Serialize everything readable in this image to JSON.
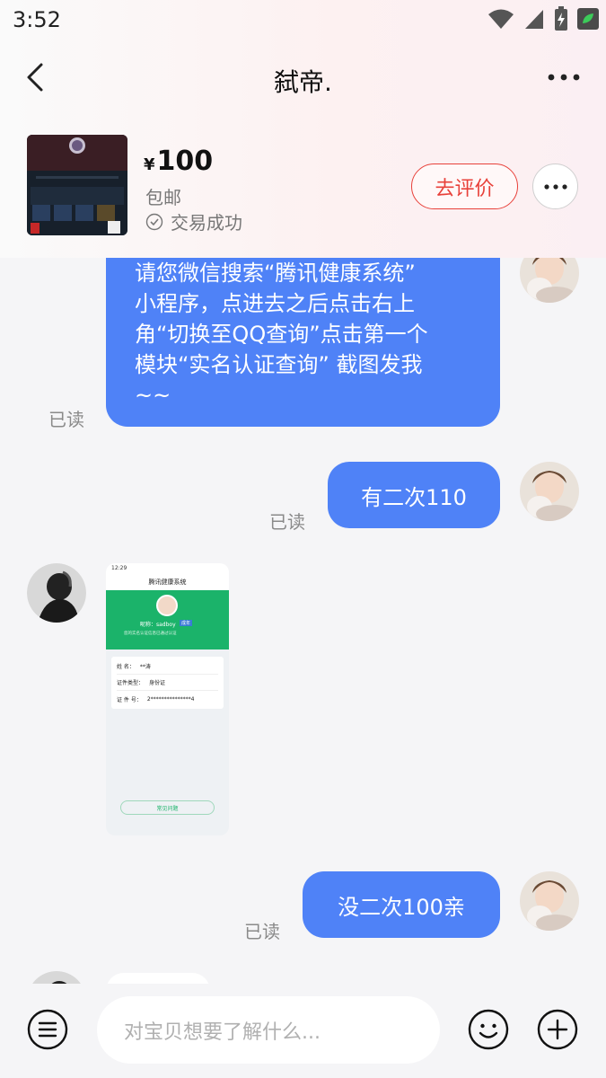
{
  "statusbar": {
    "time": "3:52"
  },
  "header": {
    "title": "弑帝."
  },
  "product": {
    "currency": "¥",
    "price": "100",
    "shipping": "包邮",
    "status": "交易成功",
    "review_button": "去评价"
  },
  "messages": [
    {
      "from": "me",
      "lines": [
        "请您微信搜索“腾讯健康系统”",
        "小程序，点进去之后点击右上",
        "角“切换至QQ查询”点击第一个",
        "模块“实名认证查询” 截图发我",
        "~~"
      ],
      "read": "已读"
    },
    {
      "from": "me",
      "text": "有二次110",
      "read": "已读"
    },
    {
      "from": "them",
      "type": "image",
      "screenshot": {
        "time": "12:29",
        "title": "腾讯健康系统",
        "nickname_label": "昵称：sadboy",
        "tag": "成年",
        "subtitle": "您的实名认证信息已通过认证",
        "rows": [
          {
            "label": "姓  名：",
            "value": "**涛"
          },
          {
            "label": "证件类型：",
            "value": "身份证"
          },
          {
            "label": "证 件 号：",
            "value": "2***************4"
          }
        ],
        "button": "常见问题"
      }
    },
    {
      "from": "me",
      "text": "没二次100亲",
      "read": "已读"
    }
  ],
  "input": {
    "placeholder": "对宝贝想要了解什么..."
  },
  "colors": {
    "accent": "#4f82f7",
    "review": "#e8413a"
  }
}
